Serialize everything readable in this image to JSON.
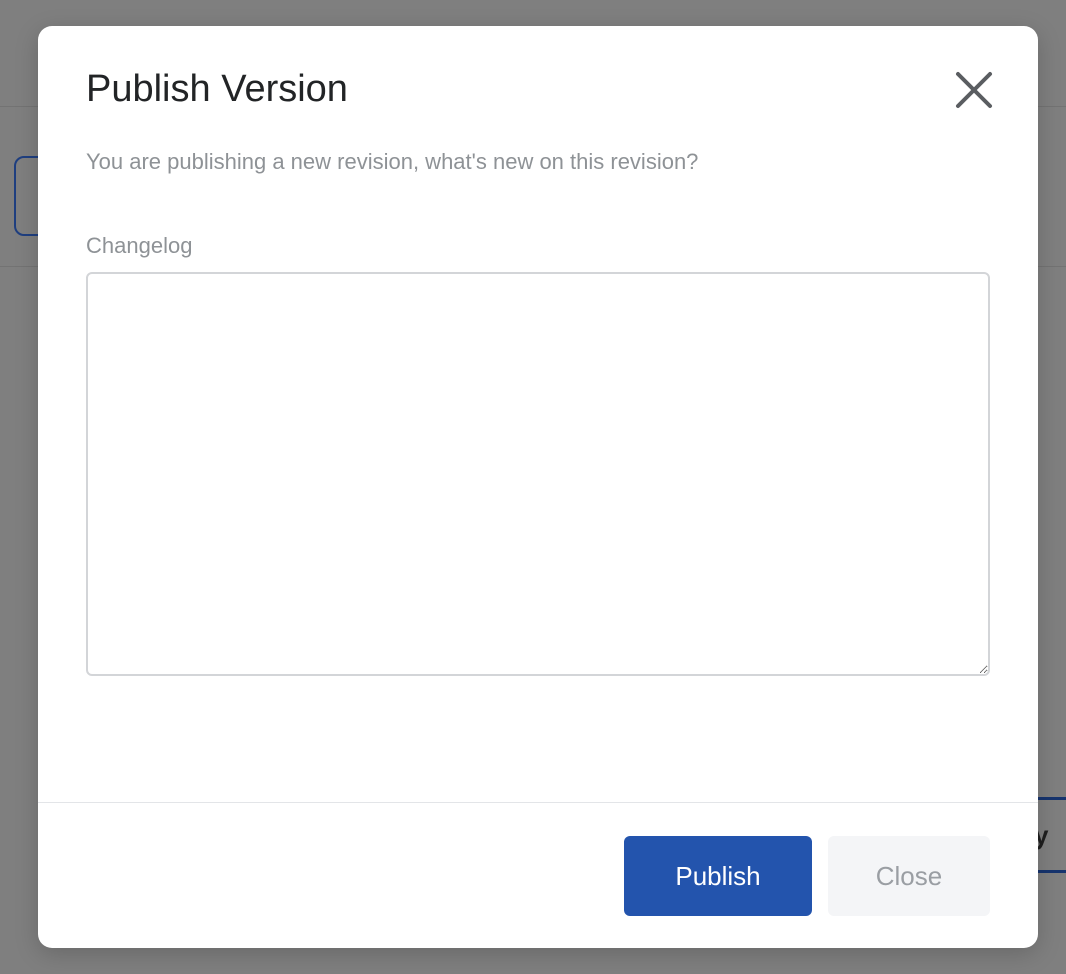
{
  "background": {
    "partial_button_label": "y"
  },
  "modal": {
    "title": "Publish Version",
    "close_icon": "close-icon",
    "subtitle": "You are publishing a new revision, what's new on this revision?",
    "changelog": {
      "label": "Changelog",
      "value": "",
      "placeholder": ""
    },
    "actions": {
      "publish_label": "Publish",
      "close_label": "Close"
    }
  },
  "colors": {
    "overlay": "#7f7f7f",
    "primary": "#2354ad",
    "secondary_bg": "#f4f5f7",
    "muted_text": "#8e9296",
    "title_text": "#222426"
  }
}
